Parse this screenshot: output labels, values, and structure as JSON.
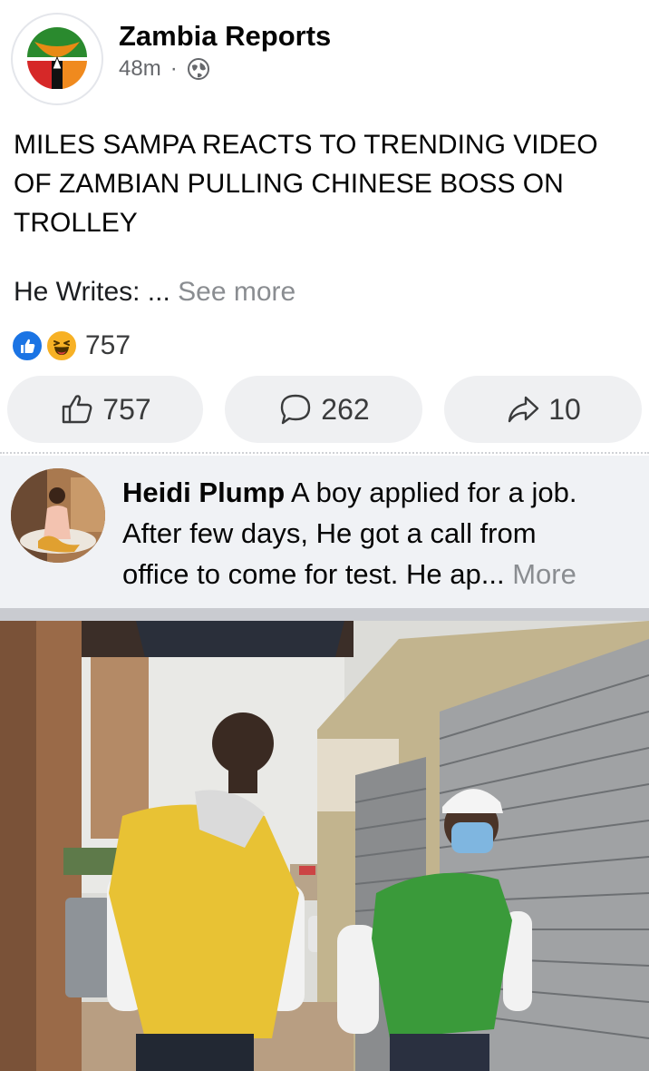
{
  "post": {
    "page_name": "Zambia Reports",
    "time": "48m",
    "separator": "·",
    "privacy_icon": "globe-icon",
    "text_lines": [
      "MILES SAMPA REACTS TO TRENDING VIDEO",
      "OF ZAMBIAN PULLING CHINESE BOSS ON",
      "TROLLEY"
    ],
    "writes": "He Writes: ...",
    "see_more": "See more"
  },
  "reactions": {
    "icons": [
      "like-icon",
      "haha-icon"
    ],
    "count": "757"
  },
  "actions": {
    "like_count": "757",
    "comment_count": "262",
    "share_count": "10"
  },
  "comment": {
    "author": "Heidi Plump",
    "lines": [
      " A boy applied for a job.",
      "After few days, He got a call from",
      "office to come for test. He ap..."
    ],
    "more": "More"
  },
  "colors": {
    "like_blue": "#1b74e4",
    "haha_yellow": "#f7b125",
    "button_bg": "#eff0f2",
    "comment_bg": "#f0f2f5",
    "muted_text": "#8a8d91"
  }
}
